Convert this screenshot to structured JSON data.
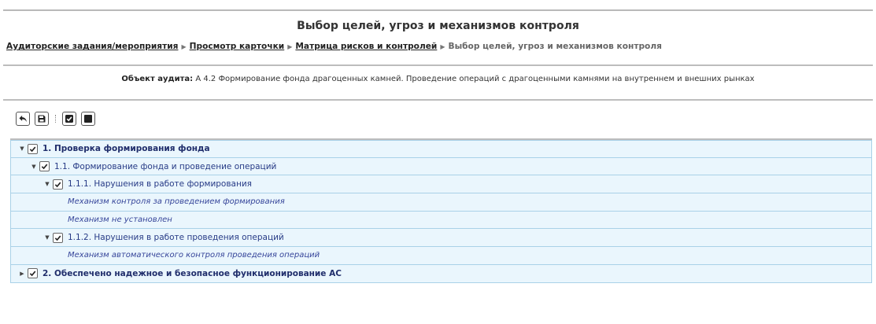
{
  "page": {
    "title": "Выбор целей, угроз и механизмов контроля"
  },
  "breadcrumb": {
    "items": [
      "Аудиторские задания/мероприятия",
      "Просмотр карточки",
      "Матрица рисков и контролей"
    ],
    "current": "Выбор целей, угроз и механизмов контроля"
  },
  "audit_object": {
    "label": "Объект аудита:",
    "value": "А 4.2 Формирование фонда драгоценных камней. Проведение операций с драгоценными камнями на внутреннем и внешних рынках"
  },
  "toolbar": {
    "buttons": [
      {
        "icon": "undo-arrow-icon"
      },
      {
        "icon": "save-icon"
      },
      {
        "icon": "check-all-icon"
      },
      {
        "icon": "uncheck-all-icon"
      }
    ]
  },
  "tree": {
    "rows": [
      {
        "label": "1. Проверка формирования фонда",
        "level": 1,
        "expanded": true,
        "checked": true
      },
      {
        "label": "1.1. Формирование фонда и проведение операций",
        "level": 2,
        "expanded": true,
        "checked": true
      },
      {
        "label": "1.1.1. Нарушения в работе формирования",
        "level": 3,
        "expanded": true,
        "checked": true
      },
      {
        "label": "Механизм контроля за проведением формирования",
        "level": 4
      },
      {
        "label": "Механизм не установлен",
        "level": 4
      },
      {
        "label": "1.1.2. Нарушения в работе проведения операций",
        "level": 3,
        "expanded": true,
        "checked": true
      },
      {
        "label": "Механизм автоматического контроля проведения операций",
        "level": 4
      },
      {
        "label": "2. Обеспечено надежное и безопасное функционирование АС",
        "level": 1,
        "expanded": false,
        "checked": true
      }
    ]
  },
  "colors": {
    "row_bg": "#eaf6fd",
    "row_border": "#a9d1e8",
    "text_link": "#273b86"
  }
}
